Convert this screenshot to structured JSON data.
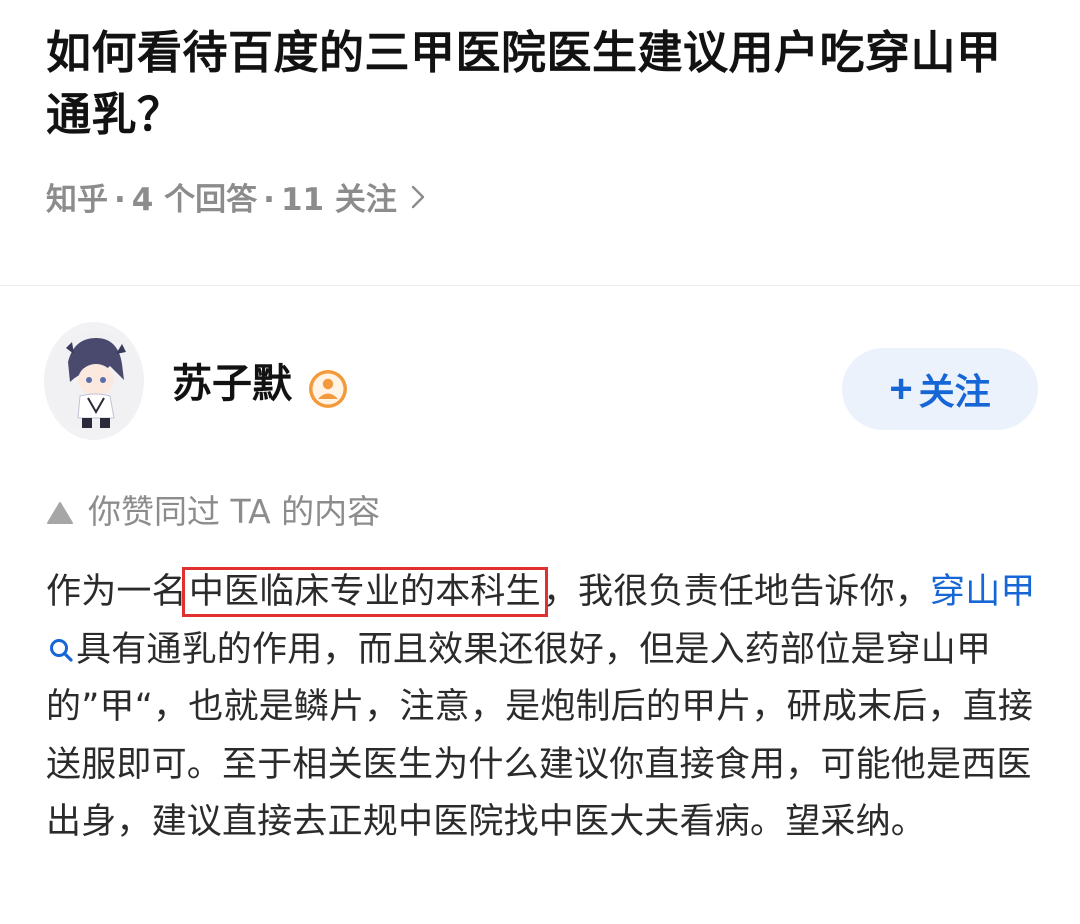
{
  "question": {
    "title": "如何看待百度的三甲医院医生建议用户吃穿山甲通乳？",
    "source": "知乎",
    "answers": "4 个回答",
    "followers": "11 关注",
    "separator": "·"
  },
  "author": {
    "name": "苏子默",
    "avatar_icon": "avatar-anime-character",
    "badge_icon": "user-badge-icon",
    "follow_label": "关注",
    "follow_plus": "+"
  },
  "answer": {
    "upvote_note": "你赞同过 TA 的内容",
    "part1": "作为一名",
    "highlighted": "中医临床专业的本科生",
    "part2": "，我很负责任地告诉你，",
    "keyword": "穿山甲",
    "part3": "具有通乳的作用，而且效果还很好，但是入药部位是穿山甲的”甲“，也就是鳞片，注意，是炮制后的甲片，研成末后，直接送服即可。至于相关医生为什么建议你直接食用，可能他是西医出身，建议直接去正规中医院找中医大夫看病。望采纳。"
  },
  "colors": {
    "link_blue": "#1766d6",
    "follow_bg": "#ebf2fb",
    "highlight_red": "#e03030",
    "meta_gray": "#8c8c8c"
  }
}
